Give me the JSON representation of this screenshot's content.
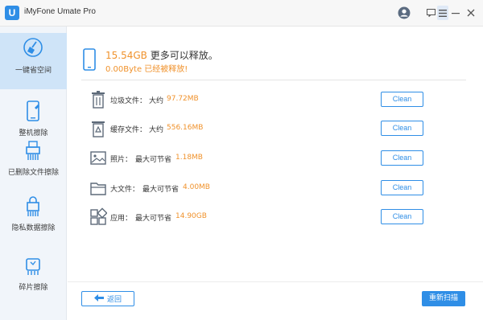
{
  "app": {
    "title": "iMyFone Umate Pro",
    "logo_letter": "U",
    "accent_color": "#2f8ee6",
    "highlight_color": "#f0922c"
  },
  "titlebar_icons": [
    "user-icon",
    "feedback-icon",
    "menu-icon",
    "minimize-icon",
    "close-icon"
  ],
  "sidebar": {
    "items": [
      {
        "label": "一键省空间",
        "icon": "broom-icon",
        "active": true
      },
      {
        "label": "整机擦除",
        "icon": "phone-erase-icon",
        "active": false
      },
      {
        "label": "已删除文件擦除",
        "icon": "shredder-icon",
        "active": false
      },
      {
        "label": "隐私数据擦除",
        "icon": "privacy-icon",
        "active": false
      },
      {
        "label": "碎片擦除",
        "icon": "fragment-icon",
        "active": false
      }
    ]
  },
  "summary": {
    "amount": "15.54GB",
    "text": " 更多可以释放。",
    "freed_amount": "0.00Byte",
    "freed_text": " 已经被释放!"
  },
  "items": [
    {
      "name": "垃圾文件：",
      "size_caption": "大约",
      "value": "97.72MB",
      "button": "Clean",
      "icon": "trash-icon"
    },
    {
      "name": "缓存文件：",
      "size_caption": "大约",
      "value": "556.16MB",
      "button": "Clean",
      "icon": "cache-icon"
    },
    {
      "name": "照片：",
      "size_caption": "最大可节省",
      "value": "1.18MB",
      "button": "Clean",
      "icon": "photo-icon"
    },
    {
      "name": "大文件：",
      "size_caption": "最大可节省",
      "value": "4.00MB",
      "button": "Clean",
      "icon": "folder-icon"
    },
    {
      "name": "应用：",
      "size_caption": "最大可节省",
      "value": "14.90GB",
      "button": "Clean",
      "icon": "apps-icon"
    }
  ],
  "footer": {
    "back_label": "返回",
    "rescan_label": "重新扫描"
  }
}
